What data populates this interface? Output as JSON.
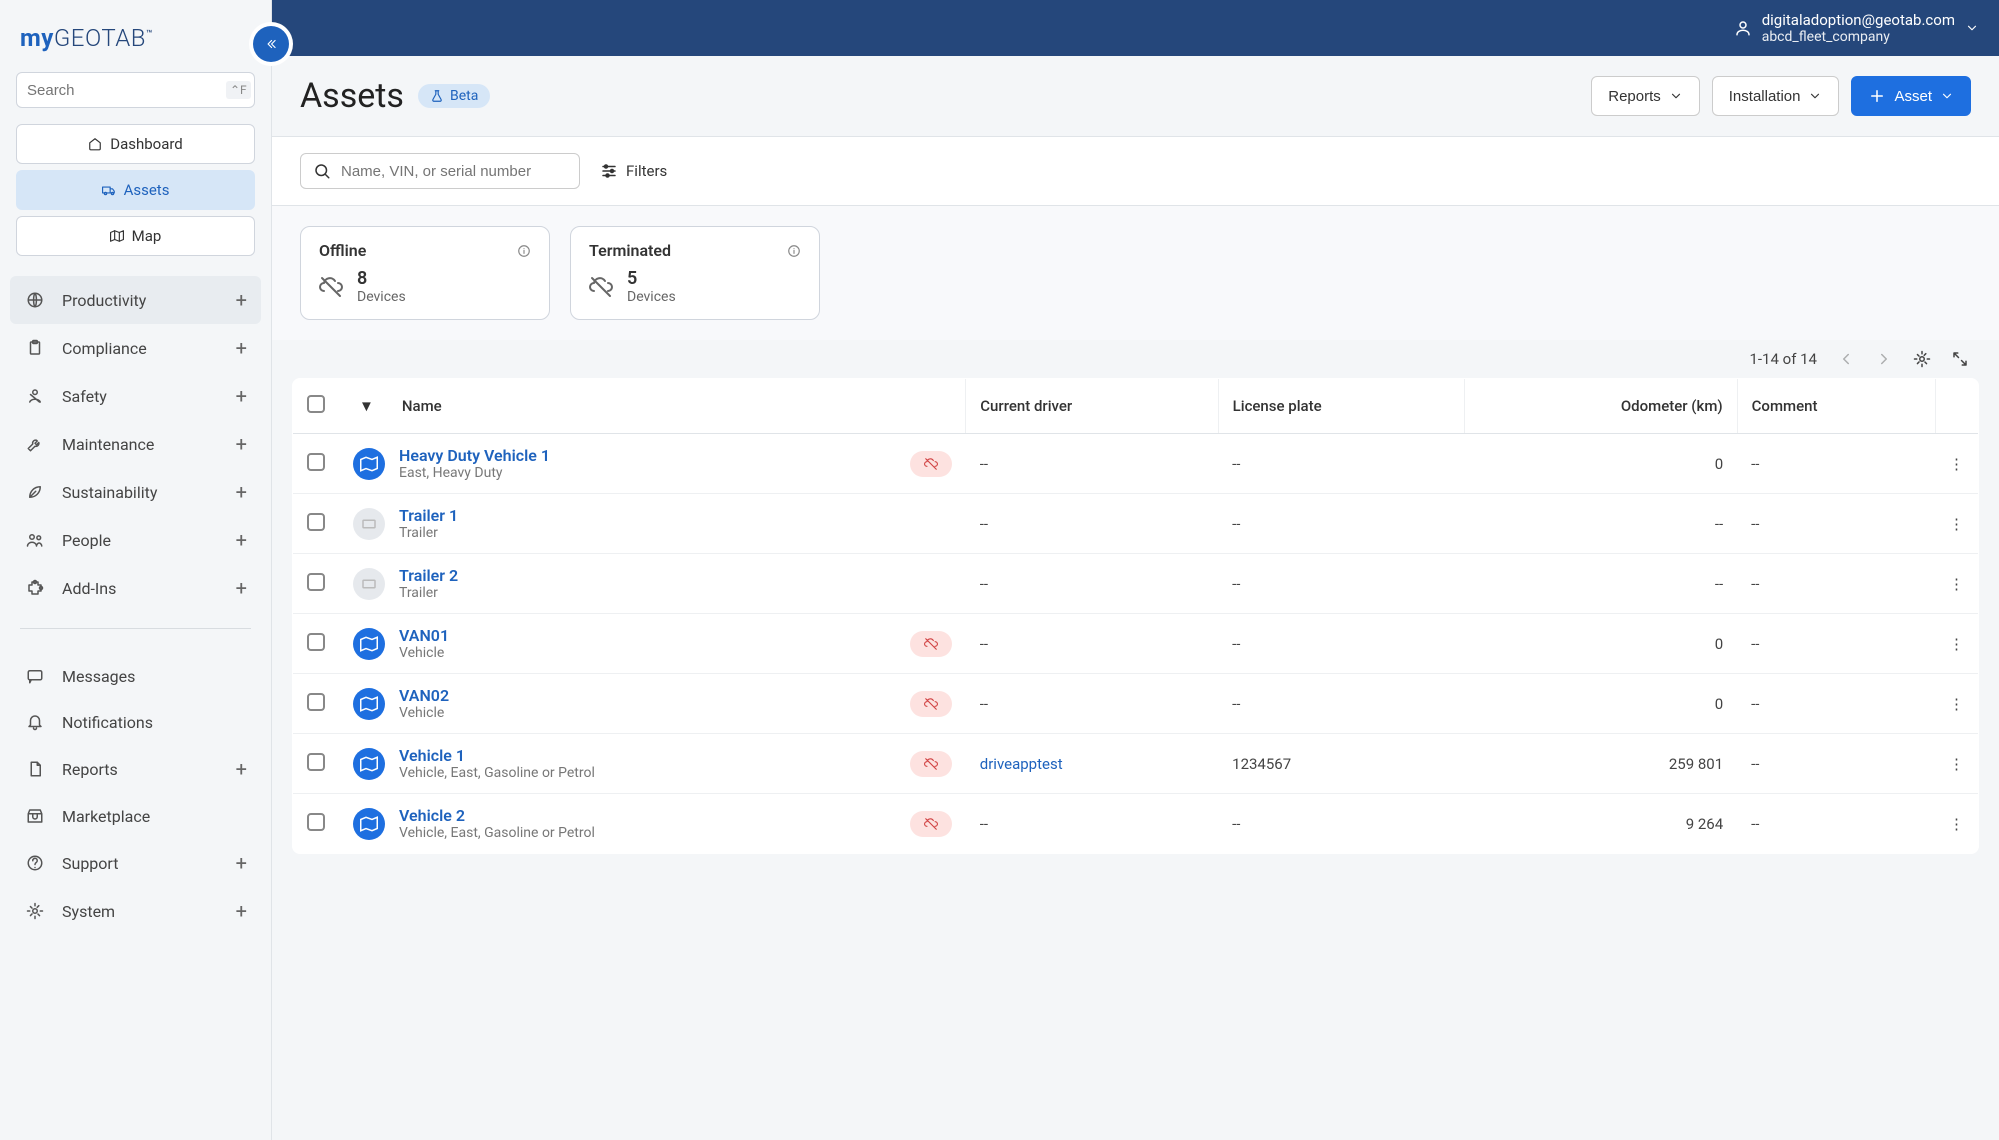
{
  "brand": {
    "prefix": "my",
    "main": "GEOTAB",
    "tm": "™"
  },
  "sidebar": {
    "search_placeholder": "Search",
    "search_kbd": "⌃F",
    "tabs": {
      "dashboard": "Dashboard",
      "assets": "Assets",
      "map": "Map"
    },
    "groups1": [
      {
        "label": "Productivity",
        "icon": "globe",
        "plus": true,
        "hl": true
      },
      {
        "label": "Compliance",
        "icon": "clipboard",
        "plus": true
      },
      {
        "label": "Safety",
        "icon": "seatbelt",
        "plus": true
      },
      {
        "label": "Maintenance",
        "icon": "wrench",
        "plus": true
      },
      {
        "label": "Sustainability",
        "icon": "leaf",
        "plus": true
      },
      {
        "label": "People",
        "icon": "people",
        "plus": true
      },
      {
        "label": "Add-Ins",
        "icon": "puzzle",
        "plus": true
      }
    ],
    "groups2": [
      {
        "label": "Messages",
        "icon": "message",
        "plus": false
      },
      {
        "label": "Notifications",
        "icon": "bell",
        "plus": false
      },
      {
        "label": "Reports",
        "icon": "file",
        "plus": true
      },
      {
        "label": "Marketplace",
        "icon": "market",
        "plus": false
      },
      {
        "label": "Support",
        "icon": "help",
        "plus": true
      },
      {
        "label": "System",
        "icon": "gear",
        "plus": true
      }
    ]
  },
  "topbar": {
    "email": "digitaladoption@geotab.com",
    "company": "abcd_fleet_company"
  },
  "page": {
    "title": "Assets",
    "beta": "Beta",
    "actions": {
      "reports": "Reports",
      "installation": "Installation",
      "asset": "Asset"
    }
  },
  "filterbar": {
    "search_placeholder": "Name, VIN, or serial number",
    "filters": "Filters"
  },
  "stats": [
    {
      "title": "Offline",
      "count": "8",
      "sub": "Devices"
    },
    {
      "title": "Terminated",
      "count": "5",
      "sub": "Devices"
    }
  ],
  "table": {
    "pagination": "1-14 of 14",
    "columns": {
      "name": "Name",
      "driver": "Current driver",
      "plate": "License plate",
      "odo": "Odometer (km)",
      "comment": "Comment"
    },
    "rows": [
      {
        "name": "Heavy Duty Vehicle 1",
        "sub": "East, Heavy Duty",
        "icon": "blue",
        "status": true,
        "driver": "--",
        "plate": "--",
        "odo": "0",
        "comment": "--"
      },
      {
        "name": "Trailer 1",
        "sub": "Trailer",
        "icon": "grey",
        "status": false,
        "driver": "--",
        "plate": "--",
        "odo": "--",
        "comment": "--"
      },
      {
        "name": "Trailer 2",
        "sub": "Trailer",
        "icon": "grey",
        "status": false,
        "driver": "--",
        "plate": "--",
        "odo": "--",
        "comment": "--"
      },
      {
        "name": "VAN01",
        "sub": "Vehicle",
        "icon": "blue",
        "status": true,
        "driver": "--",
        "plate": "--",
        "odo": "0",
        "comment": "--"
      },
      {
        "name": "VAN02",
        "sub": "Vehicle",
        "icon": "blue",
        "status": true,
        "driver": "--",
        "plate": "--",
        "odo": "0",
        "comment": "--"
      },
      {
        "name": "Vehicle 1",
        "sub": "Vehicle, East, Gasoline or Petrol",
        "icon": "blue",
        "status": true,
        "driver": "driveapptest",
        "driver_link": true,
        "plate": "1234567",
        "odo": "259 801",
        "comment": "--"
      },
      {
        "name": "Vehicle 2",
        "sub": "Vehicle, East, Gasoline or Petrol",
        "icon": "blue",
        "status": true,
        "driver": "--",
        "plate": "--",
        "odo": "9 264",
        "comment": "--"
      }
    ]
  }
}
